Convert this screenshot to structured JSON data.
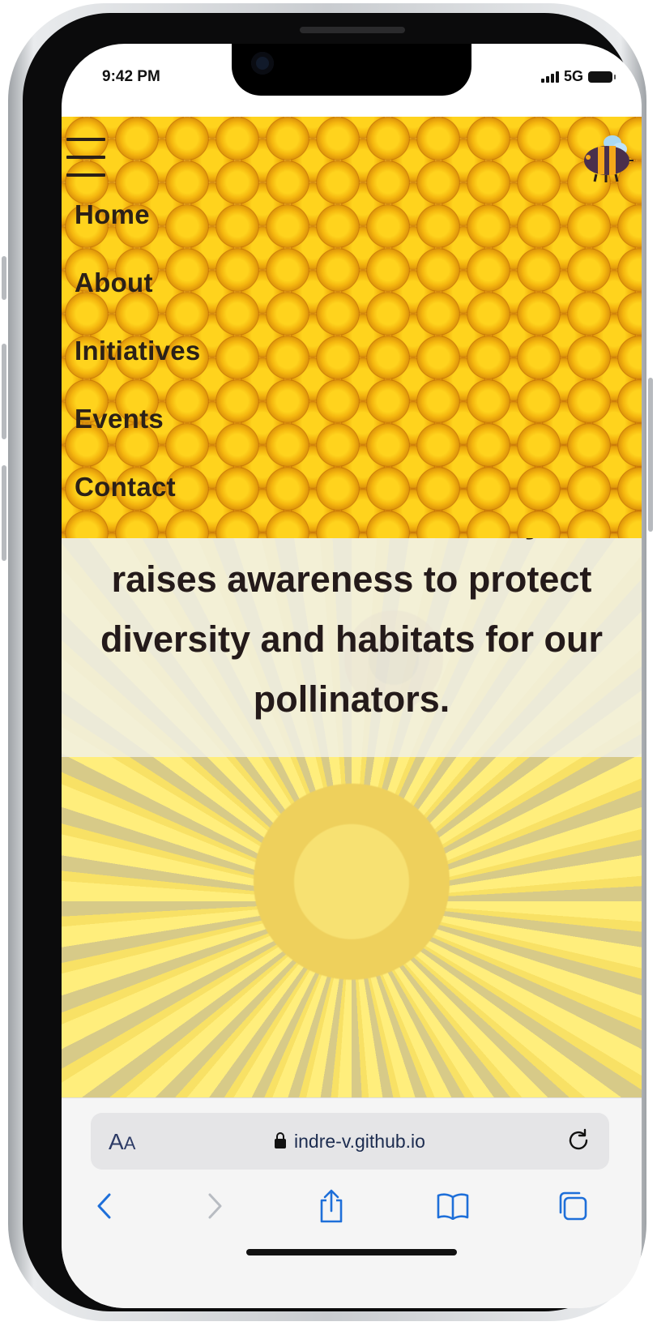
{
  "status_bar": {
    "time": "9:42 PM",
    "network": "5G"
  },
  "site": {
    "logo_icon": "bee-icon",
    "menu_icon": "hamburger-icon",
    "nav_items": [
      "Home",
      "About",
      "Initiatives",
      "Events",
      "Contact"
    ],
    "tagline": "Bee-Aware is a community that raises awareness to protect diversity and habitats for our pollinators."
  },
  "browser": {
    "text_size_big": "A",
    "text_size_small": "A",
    "url": "indre-v.github.io",
    "icons": [
      "lock-icon",
      "reload-icon",
      "back-icon",
      "forward-icon",
      "share-icon",
      "bookmarks-icon",
      "tabs-icon"
    ]
  },
  "colors": {
    "accent": "#1e6fd9",
    "nav_text": "#2b2018",
    "tagline_text": "#241a1a",
    "honey": "#f3b10a"
  }
}
